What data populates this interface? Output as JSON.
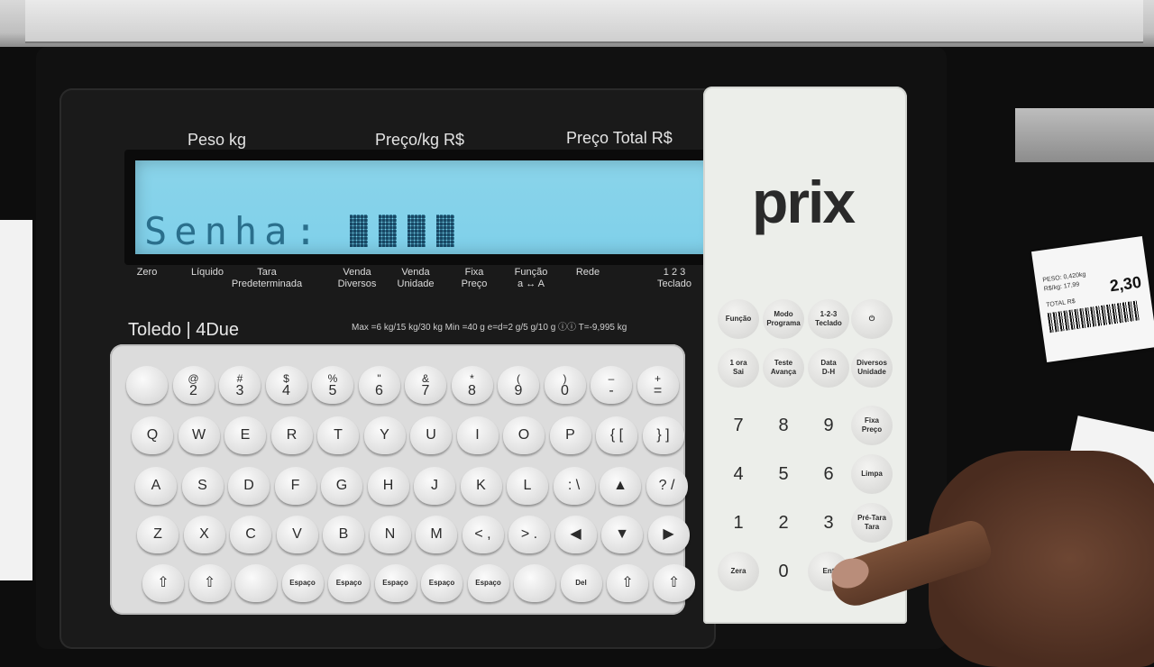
{
  "display": {
    "headers": [
      "Peso kg",
      "Preço/kg R$",
      "Preço Total R$"
    ],
    "lcd_text": "Senha:"
  },
  "under_display": {
    "labels": [
      "Zero",
      "Líquido",
      "Tara\nPredeterminada",
      "Venda\nDiversos",
      "Venda\nUnidade",
      "Fixa\nPreço",
      "Função\na ↔ A",
      "Rede",
      "1  2  3\nTeclado"
    ]
  },
  "brand": {
    "model": "Toledo  |  4Due",
    "spec": "Max =6 kg/15 kg/30 kg    Min =40 g    e=d=2 g/5 g/10 g    ⓘⓘ    T=-9,995 kg",
    "logo": "prix"
  },
  "keyboard": {
    "row1": [
      {
        "top": "",
        "main": ""
      },
      {
        "top": "@",
        "main": "2"
      },
      {
        "top": "#",
        "main": "3"
      },
      {
        "top": "$",
        "main": "4"
      },
      {
        "top": "%",
        "main": "5"
      },
      {
        "top": "\"",
        "main": "6"
      },
      {
        "top": "&",
        "main": "7"
      },
      {
        "top": "*",
        "main": "8"
      },
      {
        "top": "(",
        "main": "9"
      },
      {
        "top": ")",
        "main": "0"
      },
      {
        "top": "–",
        "main": "-"
      },
      {
        "top": "+",
        "main": "="
      }
    ],
    "row2": [
      "Q",
      "W",
      "E",
      "R",
      "T",
      "Y",
      "U",
      "I",
      "O",
      "P",
      "{ [",
      "} ]"
    ],
    "row3": [
      "A",
      "S",
      "D",
      "F",
      "G",
      "H",
      "J",
      "K",
      "L",
      ": \\",
      "▲",
      "? /"
    ],
    "row4": [
      "Z",
      "X",
      "C",
      "V",
      "B",
      "N",
      "M",
      "< ,",
      "> .",
      "◀",
      "▼",
      "▶"
    ],
    "row5": [
      "⇧",
      "⇧",
      "",
      "Espaço",
      "Espaço",
      "Espaço",
      "Espaço",
      "Espaço",
      "",
      "Del",
      "⇧",
      "⇧"
    ]
  },
  "right_keys": {
    "row1": [
      "Função",
      "Modo\nPrograma",
      "1-2-3\nTeclado",
      "⏻"
    ],
    "row2": [
      "1 ora\nSai",
      "Teste\nAvança",
      "Data\nD-H",
      "Diversos\nUnidade"
    ],
    "row3": [
      "7",
      "8",
      "9",
      "Fixa\nPreço"
    ],
    "row4": [
      "4",
      "5",
      "6",
      "Limpa"
    ],
    "row5": [
      "1",
      "2",
      "3",
      "Pré-Tara\nTara"
    ],
    "row6": [
      "Zera",
      "0",
      "Ent",
      ""
    ]
  },
  "receipt": {
    "peso": "PESO: 0,420kg",
    "rs_kg": "R$/kg: 17,99",
    "total": "TOTAL  R$",
    "price": "2,30"
  }
}
